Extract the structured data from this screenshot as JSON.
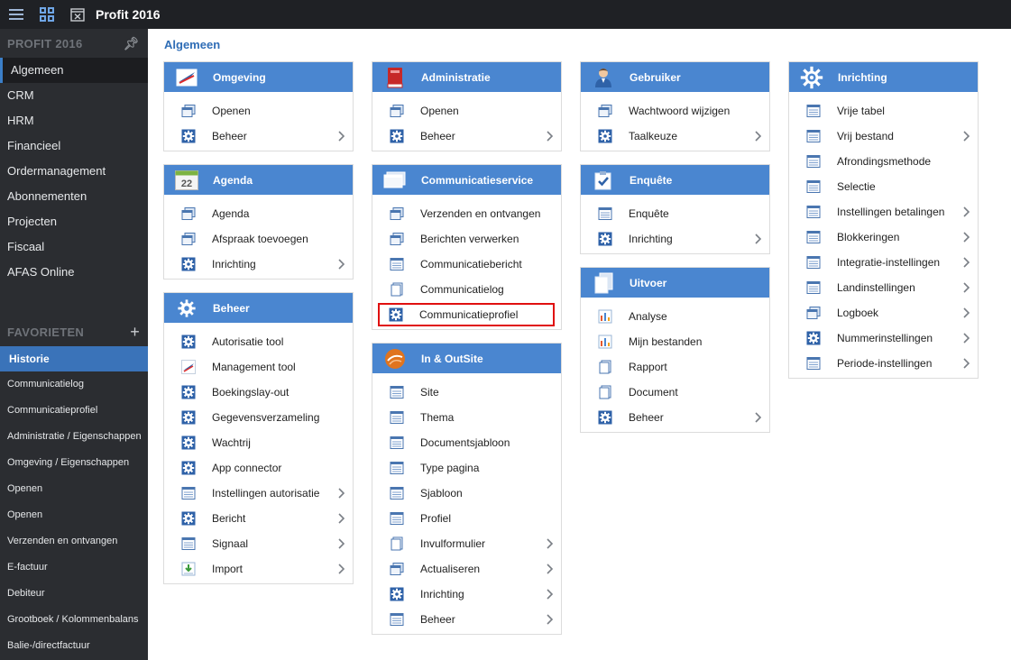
{
  "topbar": {
    "title": "Profit 2016"
  },
  "sidebar": {
    "section_title": "PROFIT 2016",
    "nav": [
      {
        "label": "Algemeen",
        "active": true
      },
      {
        "label": "CRM"
      },
      {
        "label": "HRM"
      },
      {
        "label": "Financieel"
      },
      {
        "label": "Ordermanagement"
      },
      {
        "label": "Abonnementen"
      },
      {
        "label": "Projecten"
      },
      {
        "label": "Fiscaal"
      },
      {
        "label": "AFAS Online"
      }
    ],
    "favorites_title": "FAVORIETEN",
    "history_title": "Historie",
    "history": [
      {
        "label": "Communicatielog"
      },
      {
        "label": "Communicatieprofiel"
      },
      {
        "label": "Administratie / Eigenschappen"
      },
      {
        "label": "Omgeving / Eigenschappen"
      },
      {
        "label": "Openen"
      },
      {
        "label": "Openen"
      },
      {
        "label": "Verzenden en ontvangen"
      },
      {
        "label": "E-factuur"
      },
      {
        "label": "Debiteur"
      },
      {
        "label": "Grootboek / Kolommenbalans"
      },
      {
        "label": "Balie-/directfactuur"
      }
    ]
  },
  "main": {
    "title": "Algemeen",
    "columns": [
      [
        {
          "title": "Omgeving",
          "icon": "omgeving-logo-icon",
          "items": [
            {
              "label": "Openen",
              "icon": "window-icon"
            },
            {
              "label": "Beheer",
              "icon": "gear-icon",
              "chevron": true
            }
          ]
        },
        {
          "title": "Agenda",
          "icon": "calendar-icon",
          "calendar_day": "22",
          "items": [
            {
              "label": "Agenda",
              "icon": "window-icon"
            },
            {
              "label": "Afspraak toevoegen",
              "icon": "window-icon"
            },
            {
              "label": "Inrichting",
              "icon": "gear-icon",
              "chevron": true
            }
          ]
        },
        {
          "title": "Beheer",
          "icon": "gear-icon",
          "items": [
            {
              "label": "Autorisatie tool",
              "icon": "gear-icon"
            },
            {
              "label": "Management tool",
              "icon": "omgeving-logo-icon"
            },
            {
              "label": "Boekingslay-out",
              "icon": "gear-icon"
            },
            {
              "label": "Gegevensverzameling",
              "icon": "gear-icon"
            },
            {
              "label": "Wachtrij",
              "icon": "gear-icon"
            },
            {
              "label": "App connector",
              "icon": "gear-icon"
            },
            {
              "label": "Instellingen autorisatie",
              "icon": "list-icon",
              "chevron": true
            },
            {
              "label": "Bericht",
              "icon": "gear-icon",
              "chevron": true
            },
            {
              "label": "Signaal",
              "icon": "list-icon",
              "chevron": true
            },
            {
              "label": "Import",
              "icon": "import-icon",
              "chevron": true
            }
          ]
        }
      ],
      [
        {
          "title": "Administratie",
          "icon": "book-icon",
          "items": [
            {
              "label": "Openen",
              "icon": "window-icon"
            },
            {
              "label": "Beheer",
              "icon": "gear-icon",
              "chevron": true
            }
          ]
        },
        {
          "title": "Communicatieservice",
          "icon": "monitor-icon",
          "items": [
            {
              "label": "Verzenden en ontvangen",
              "icon": "window-icon"
            },
            {
              "label": "Berichten verwerken",
              "icon": "window-icon"
            },
            {
              "label": "Communicatiebericht",
              "icon": "list-icon"
            },
            {
              "label": "Communicatielog",
              "icon": "page-icon"
            },
            {
              "label": "Communicatieprofiel",
              "icon": "gear-icon",
              "highlight": true
            }
          ]
        },
        {
          "title": "In & OutSite",
          "icon": "globe-icon",
          "items": [
            {
              "label": "Site",
              "icon": "list-icon"
            },
            {
              "label": "Thema",
              "icon": "list-icon"
            },
            {
              "label": "Documentsjabloon",
              "icon": "list-icon"
            },
            {
              "label": "Type pagina",
              "icon": "list-icon"
            },
            {
              "label": "Sjabloon",
              "icon": "list-icon"
            },
            {
              "label": "Profiel",
              "icon": "list-icon"
            },
            {
              "label": "Invulformulier",
              "icon": "page-icon",
              "chevron": true
            },
            {
              "label": "Actualiseren",
              "icon": "window-icon",
              "chevron": true
            },
            {
              "label": "Inrichting",
              "icon": "gear-icon",
              "chevron": true
            },
            {
              "label": "Beheer",
              "icon": "list-icon",
              "chevron": true
            }
          ]
        }
      ],
      [
        {
          "title": "Gebruiker",
          "icon": "user-icon",
          "items": [
            {
              "label": "Wachtwoord wijzigen",
              "icon": "window-icon"
            },
            {
              "label": "Taalkeuze",
              "icon": "gear-icon",
              "chevron": true
            }
          ]
        },
        {
          "title": "Enquête",
          "icon": "checkbox-icon",
          "items": [
            {
              "label": "Enquête",
              "icon": "list-icon"
            },
            {
              "label": "Inrichting",
              "icon": "gear-icon",
              "chevron": true
            }
          ]
        },
        {
          "title": "Uitvoer",
          "icon": "pages-icon",
          "items": [
            {
              "label": "Analyse",
              "icon": "chart-icon"
            },
            {
              "label": "Mijn bestanden",
              "icon": "chart-icon"
            },
            {
              "label": "Rapport",
              "icon": "page-icon"
            },
            {
              "label": "Document",
              "icon": "page-icon"
            },
            {
              "label": "Beheer",
              "icon": "gear-icon",
              "chevron": true
            }
          ]
        }
      ],
      [
        {
          "title": "Inrichting",
          "icon": "big-gear-icon",
          "items": [
            {
              "label": "Vrije tabel",
              "icon": "list-icon"
            },
            {
              "label": "Vrij bestand",
              "icon": "list-icon",
              "chevron": true
            },
            {
              "label": "Afrondingsmethode",
              "icon": "list-icon"
            },
            {
              "label": "Selectie",
              "icon": "list-icon"
            },
            {
              "label": "Instellingen betalingen",
              "icon": "list-icon",
              "chevron": true
            },
            {
              "label": "Blokkeringen",
              "icon": "list-icon",
              "chevron": true
            },
            {
              "label": "Integratie-instellingen",
              "icon": "list-icon",
              "chevron": true
            },
            {
              "label": "Landinstellingen",
              "icon": "list-icon",
              "chevron": true
            },
            {
              "label": "Logboek",
              "icon": "window-icon",
              "chevron": true
            },
            {
              "label": "Nummerinstellingen",
              "icon": "gear-icon",
              "chevron": true
            },
            {
              "label": "Periode-instellingen",
              "icon": "list-icon",
              "chevron": true
            }
          ]
        }
      ]
    ]
  }
}
